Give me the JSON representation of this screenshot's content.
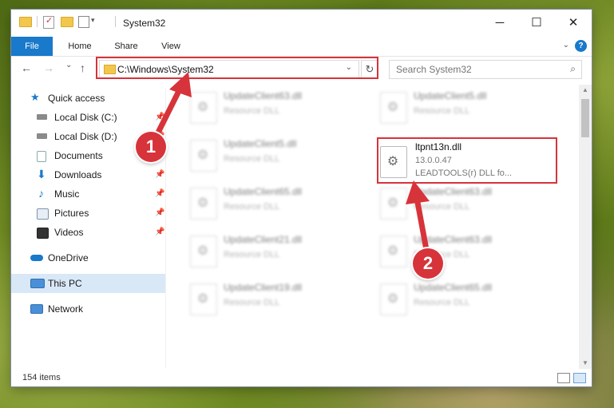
{
  "window": {
    "title": "System32",
    "minimize": "─",
    "maximize": "☐",
    "close": "✕"
  },
  "ribbon": {
    "tabs": [
      "File",
      "Home",
      "Share",
      "View"
    ],
    "collapse": "⌄",
    "help": "?"
  },
  "nav": {
    "back": "←",
    "forward": "→",
    "recent": "⌄",
    "up": "↑"
  },
  "address": {
    "path": "C:\\Windows\\System32",
    "dropdown": "⌄",
    "refresh": "↻"
  },
  "search": {
    "placeholder": "Search System32",
    "icon": "search-icon"
  },
  "sidebar": {
    "items": [
      {
        "label": "Quick access",
        "icon": "star-icon",
        "pinned": false
      },
      {
        "label": "Local Disk (C:)",
        "icon": "drive-icon",
        "pinned": true
      },
      {
        "label": "Local Disk (D:)",
        "icon": "drive-icon",
        "pinned": true
      },
      {
        "label": "Documents",
        "icon": "documents-icon",
        "pinned": true
      },
      {
        "label": "Downloads",
        "icon": "download-icon",
        "pinned": true
      },
      {
        "label": "Music",
        "icon": "music-icon",
        "pinned": true
      },
      {
        "label": "Pictures",
        "icon": "pictures-icon",
        "pinned": true
      },
      {
        "label": "Videos",
        "icon": "videos-icon",
        "pinned": true
      },
      {
        "label": "OneDrive",
        "icon": "cloud-icon",
        "pinned": false
      },
      {
        "label": "This PC",
        "icon": "computer-icon",
        "pinned": false,
        "selected": true
      },
      {
        "label": "Network",
        "icon": "network-icon",
        "pinned": false
      }
    ]
  },
  "files": {
    "left": [
      {
        "name": "UpdateClient63.dll",
        "type": "Resource DLL"
      },
      {
        "name": "UpdateClient5.dll",
        "type": "Resource DLL"
      },
      {
        "name": "UpdateClient65.dll",
        "type": "Resource DLL"
      },
      {
        "name": "UpdateClient21.dll",
        "type": "Resource DLL"
      },
      {
        "name": "UpdateClient19.dll",
        "type": "Resource DLL"
      }
    ],
    "right": [
      {
        "name": "UpdateClient5.dll",
        "type": "Resource DLL"
      },
      {
        "name": "UpdateClient63.dll",
        "type": "Resource DLL"
      },
      {
        "name": "UpdateClient63.dll",
        "type": "Resource DLL"
      },
      {
        "name": "UpdateClient65.dll",
        "type": "Resource DLL"
      }
    ],
    "highlighted": {
      "name": "ltpnt13n.dll",
      "version": "13.0.0.47",
      "description": "LEADTOOLS(r) DLL fo..."
    }
  },
  "status": {
    "count": "154 items"
  },
  "annotations": {
    "step1": "1",
    "step2": "2",
    "color": "#d7333a"
  },
  "colors": {
    "accent": "#1979ca",
    "selection": "#d9e8f7"
  }
}
